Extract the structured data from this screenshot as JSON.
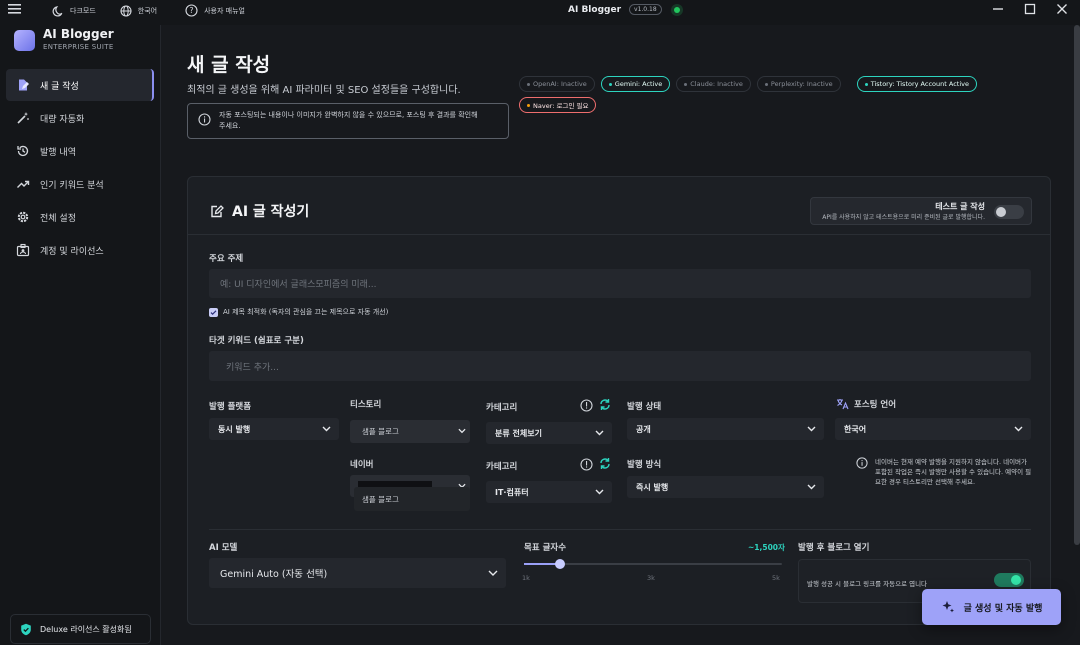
{
  "titlebar": {
    "menu_icon": "hamburger-icon",
    "dark_mode": "다크모드",
    "language": "한국어",
    "manual": "사용자 매뉴얼",
    "app_name": "AI Blogger",
    "version": "v1.0.18"
  },
  "brand": {
    "name": "AI Blogger",
    "subtitle": "ENTERPRISE SUITE"
  },
  "sidebar": {
    "items": [
      {
        "label": "새 글 작성",
        "icon": "edit-document-icon"
      },
      {
        "label": "대량 자동화",
        "icon": "magic-wand-icon"
      },
      {
        "label": "발행 내역",
        "icon": "history-icon"
      },
      {
        "label": "인기 키워드 분석",
        "icon": "trending-icon"
      },
      {
        "label": "전체 설정",
        "icon": "gear-icon"
      },
      {
        "label": "계정 및 라이선스",
        "icon": "account-badge-icon"
      }
    ],
    "license": "Deluxe 라이선스 활성화됨"
  },
  "page": {
    "title": "새 글 작성",
    "subtitle": "최적의 글 생성을 위해 AI 파라미터 및 SEO 설정들을 구성합니다.",
    "notice_line1": "자동 포스팅되는 내용이나 이미지가 완벽하지 않을 수 있으므로, 포스팅 후 결과를 확인해",
    "notice_line2": "주세요."
  },
  "status": {
    "openai": "OpenAI: Inactive",
    "gemini": "Gemini: Active",
    "claude": "Claude: Inactive",
    "perplexity": "Perplexity: Inactive",
    "tistory": "Tistory: Tistory Account Active",
    "naver": "Naver: 로그인 필요"
  },
  "editor": {
    "title": "AI 글 작성기",
    "test_title": "테스트 글 작성",
    "test_desc": "API를 사용하지 않고 테스트용으로 미리 준비된 글로 발행합니다.",
    "topic_label": "주요 주제",
    "topic_placeholder": "예: UI 디자인에서 글래스모피즘의 미래...",
    "title_opt": "AI 제목 최적화 (독자의 관심을 끄는 제목으로 자동 개선)",
    "keyword_label": "타겟 키워드 (쉼표로 구분)",
    "keyword_placeholder": "키워드 추가...",
    "platform_label": "발행 플랫폼",
    "platform_value": "동시 발행",
    "tistory_label": "티스토리",
    "tistory_value": "샘플 블로그",
    "category_label": "카테고리",
    "category_value1": "분류 전체보기",
    "status_label": "발행 상태",
    "status_value": "공개",
    "lang_label": "포스팅 언어",
    "lang_value": "한국어",
    "naver_label": "네이버",
    "naver_value": "샘플 블로그",
    "category_label2": "카테고리",
    "category_value2": "IT·컴퓨터",
    "method_label": "발행 방식",
    "method_value": "즉시 발행",
    "naver_note": "네이버는 현재 예약 발행을 지원하지 않습니다. 네이버가 포함된 작업은 즉시 발행만 사용할 수 있습니다. 예약이 필요한 경우 티스토리만 선택해 주세요.",
    "model_label": "AI 모델",
    "model_value": "Gemini Auto (자동 선택)",
    "length_label": "목표 글자수",
    "length_value": "~1,500자",
    "length_fraction": 0.14,
    "tick_1k": "1k",
    "tick_3k": "3k",
    "tick_5k": "5k",
    "open_label": "발행 후 블로그 열기",
    "open_desc": "발행 성공 시 블로그 링크를 자동으로 엽니다",
    "cta": "글 생성 및 자동 발행"
  },
  "colors": {
    "accent": "#9ea2f8",
    "active": "#2dd4bf",
    "warn": "#ef6e6e",
    "online": "#22c55e"
  }
}
